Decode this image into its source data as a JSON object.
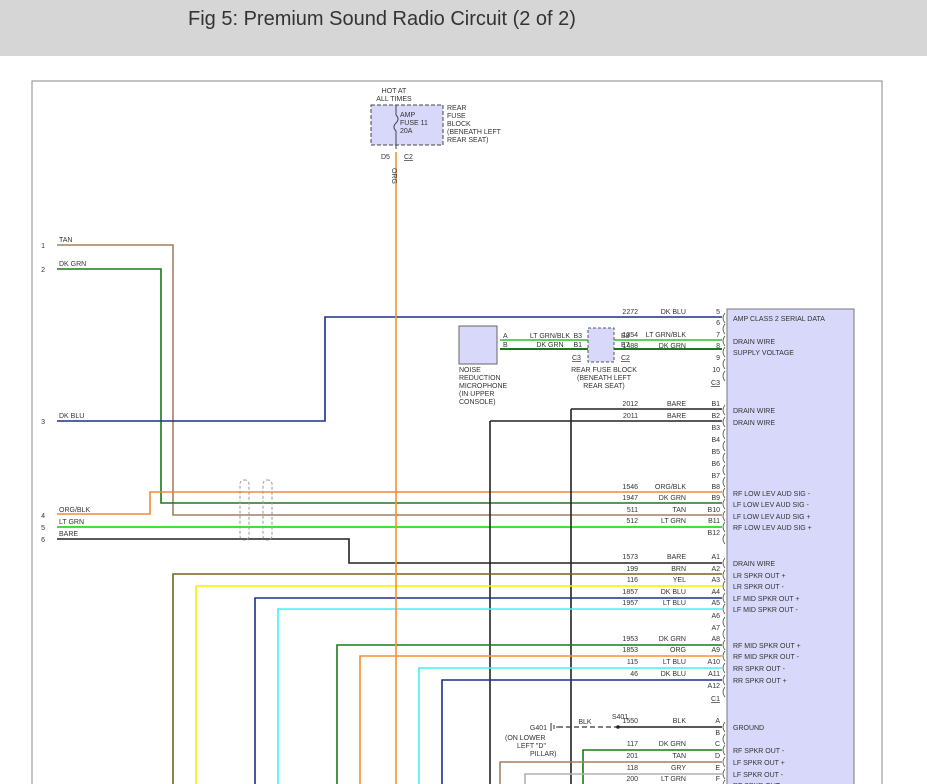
{
  "title": "Fig 5: Premium Sound Radio Circuit (2 of 2)",
  "colors": {
    "TAN": "#a08060",
    "DK GRN": "#1a7a1a",
    "DK BLU": "#1c2e8c",
    "ORG/BLK": "#f0883a",
    "LT GRN": "#40e040",
    "BARE": "#222222",
    "BRN": "#7a6020",
    "YEL": "#f4f000",
    "LT BLU": "#40f0f0",
    "ORG": "#f59030",
    "GRY": "#b0b0b0",
    "BLK": "#222222",
    "LT GRN/BLK": "#60d060",
    "module_fill": "#d8d8fa"
  },
  "fuse": {
    "hot": [
      "HOT AT",
      "ALL TIMES"
    ],
    "label": [
      "AMP",
      "FUSE 11",
      "20A"
    ],
    "block": [
      "REAR",
      "FUSE",
      "BLOCK",
      "(BENEATH LEFT",
      "REAR SEAT)"
    ],
    "pin": "D5",
    "conn": "C2",
    "wire_color": "ORG"
  },
  "left_wires": [
    {
      "num": "1",
      "color": "TAN"
    },
    {
      "num": "2",
      "color": "DK GRN"
    },
    {
      "num": "3",
      "color": "DK BLU"
    },
    {
      "num": "4",
      "color": "ORG/BLK"
    },
    {
      "num": "5",
      "color": "LT GRN"
    },
    {
      "num": "6",
      "color": "BARE"
    }
  ],
  "microphone": {
    "label": [
      "NOISE",
      "REDUCTION",
      "MICROPHONE",
      "(IN UPPER",
      "CONSOLE)"
    ],
    "pins": [
      {
        "pin": "A",
        "color": "LT GRN/BLK"
      },
      {
        "pin": "B",
        "color": "DK GRN"
      }
    ]
  },
  "rear_fuse_block": {
    "label": [
      "REAR FUSE BLOCK",
      "(BENEATH LEFT",
      "REAR SEAT)"
    ],
    "in_pins": [
      "B3",
      "B1"
    ],
    "in_conn": "C3",
    "out_pins": [
      "E8",
      "E7"
    ],
    "out_conn": "C2"
  },
  "amp_pins": [
    {
      "pin": "5",
      "circuit": "2272",
      "color": "DK BLU",
      "label": "AMP CLASS 2 SERIAL DATA"
    },
    {
      "pin": "6"
    },
    {
      "pin": "7",
      "circuit": "1354",
      "color": "LT GRN/BLK",
      "label": "DRAIN WIRE"
    },
    {
      "pin": "8",
      "circuit": "1488",
      "color": "DK GRN",
      "label": "SUPPLY VOLTAGE"
    },
    {
      "pin": "9"
    },
    {
      "pin": "10"
    },
    {
      "conn": "C3"
    },
    {
      "pin": "B1",
      "circuit": "2012",
      "color": "BARE",
      "label": "DRAIN WIRE"
    },
    {
      "pin": "B2",
      "circuit": "2011",
      "color": "BARE",
      "label": "DRAIN WIRE"
    },
    {
      "pin": "B3"
    },
    {
      "pin": "B4"
    },
    {
      "pin": "B5"
    },
    {
      "pin": "B6"
    },
    {
      "pin": "B7"
    },
    {
      "pin": "B8",
      "circuit": "1546",
      "color": "ORG/BLK",
      "label": "RF LOW LEV AUD SIG -"
    },
    {
      "pin": "B9",
      "circuit": "1947",
      "color": "DK GRN",
      "label": "LF LOW LEV AUD SIG -"
    },
    {
      "pin": "B10",
      "circuit": "511",
      "color": "TAN",
      "label": "LF LOW LEV AUD SIG +"
    },
    {
      "pin": "B11",
      "circuit": "512",
      "color": "LT GRN",
      "label": "RF LOW LEV AUD SIG +"
    },
    {
      "pin": "B12"
    },
    {
      "pin": "A1",
      "circuit": "1573",
      "color": "BARE",
      "label": "DRAIN WIRE"
    },
    {
      "pin": "A2",
      "circuit": "199",
      "color": "BRN",
      "label": "LR SPKR OUT +"
    },
    {
      "pin": "A3",
      "circuit": "116",
      "color": "YEL",
      "label": "LR SPKR OUT -"
    },
    {
      "pin": "A4",
      "circuit": "1857",
      "color": "DK BLU",
      "label": "LF MID SPKR OUT +"
    },
    {
      "pin": "A5",
      "circuit": "1957",
      "color": "LT BLU",
      "label": "LF MID SPKR OUT -"
    },
    {
      "pin": "A6"
    },
    {
      "pin": "A7"
    },
    {
      "pin": "A8",
      "circuit": "1953",
      "color": "DK GRN",
      "label": "RF MID SPKR OUT +"
    },
    {
      "pin": "A9",
      "circuit": "1853",
      "color": "ORG",
      "label": "RF MID SPKR OUT -"
    },
    {
      "pin": "A10",
      "circuit": "115",
      "color": "LT BLU",
      "label": "RR SPKR OUT -"
    },
    {
      "pin": "A11",
      "circuit": "46",
      "color": "DK BLU",
      "label": "RR SPKR OUT +"
    },
    {
      "pin": "A12"
    },
    {
      "conn": "C1"
    },
    {
      "pin": "A",
      "circuit": "1550",
      "color": "BLK",
      "label": "GROUND"
    },
    {
      "pin": "B"
    },
    {
      "pin": "C",
      "circuit": "117",
      "color": "DK GRN",
      "label": "RF SPKR OUT -"
    },
    {
      "pin": "D",
      "circuit": "201",
      "color": "TAN",
      "label": "LF SPKR OUT +"
    },
    {
      "pin": "E",
      "circuit": "118",
      "color": "GRY",
      "label": "LF SPKR OUT -"
    },
    {
      "pin": "F",
      "circuit": "200",
      "color": "LT GRN",
      "label": "RF SPKR OUT -"
    }
  ],
  "ground": {
    "name": "G401",
    "location": [
      "(ON LOWER",
      "LEFT \"D\"",
      "PILLAR)"
    ],
    "splice": "S401",
    "wire_color": "BLK"
  }
}
